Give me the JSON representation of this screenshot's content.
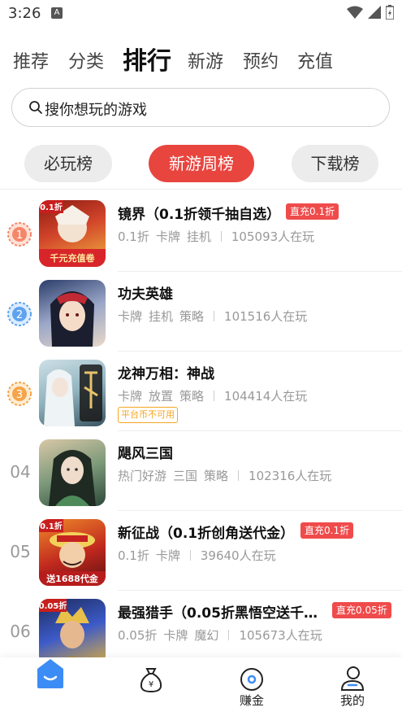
{
  "status_bar": {
    "time": "3:26"
  },
  "top_tabs": [
    {
      "label": "推荐"
    },
    {
      "label": "分类"
    },
    {
      "label": "排行"
    },
    {
      "label": "新游"
    },
    {
      "label": "预约"
    },
    {
      "label": "充值"
    }
  ],
  "search": {
    "placeholder": "搜你想玩的游戏"
  },
  "rank_tabs": [
    {
      "label": "必玩榜"
    },
    {
      "label": "新游周榜"
    },
    {
      "label": "下载榜"
    }
  ],
  "games": [
    {
      "rank": "1",
      "title": "镜界（0.1折领千抽自选）",
      "badge": "直充0.1折",
      "tags": [
        "0.1折",
        "卡牌",
        "挂机"
      ],
      "players": "105093人在玩",
      "icon_text": "千元充值卷",
      "icon_corner": "0.1折"
    },
    {
      "rank": "2",
      "title": "功夫英雄",
      "badge": "",
      "tags": [
        "卡牌",
        "挂机",
        "策略"
      ],
      "players": "101516人在玩"
    },
    {
      "rank": "3",
      "title": "龙神万相：神战",
      "badge": "",
      "tags": [
        "卡牌",
        "放置",
        "策略"
      ],
      "players": "104414人在玩",
      "warning": "平台币不可用"
    },
    {
      "rank": "04",
      "title": "飓风三国",
      "badge": "",
      "tags": [
        "热门好游",
        "三国",
        "策略"
      ],
      "players": "102316人在玩"
    },
    {
      "rank": "05",
      "title": "新征战（0.1折创角送代金）",
      "badge": "直充0.1折",
      "tags": [
        "0.1折",
        "卡牌"
      ],
      "players": "39640人在玩",
      "icon_text": "送1688代金",
      "icon_corner": "0.1折"
    },
    {
      "rank": "06",
      "title": "最强猎手（0.05折黑悟空送千…",
      "badge": "直充0.05折",
      "tags": [
        "0.05折",
        "卡牌",
        "魔幻"
      ],
      "players": "105673人在玩",
      "icon_corner": "0.05折"
    }
  ],
  "bottom_nav": [
    {
      "label": ""
    },
    {
      "label": ""
    },
    {
      "label": "赚金"
    },
    {
      "label": "我的"
    }
  ],
  "colors": {
    "accent": "#e8453f",
    "badge": "#f04b4b",
    "nav_blue": "#2f7bf5"
  }
}
